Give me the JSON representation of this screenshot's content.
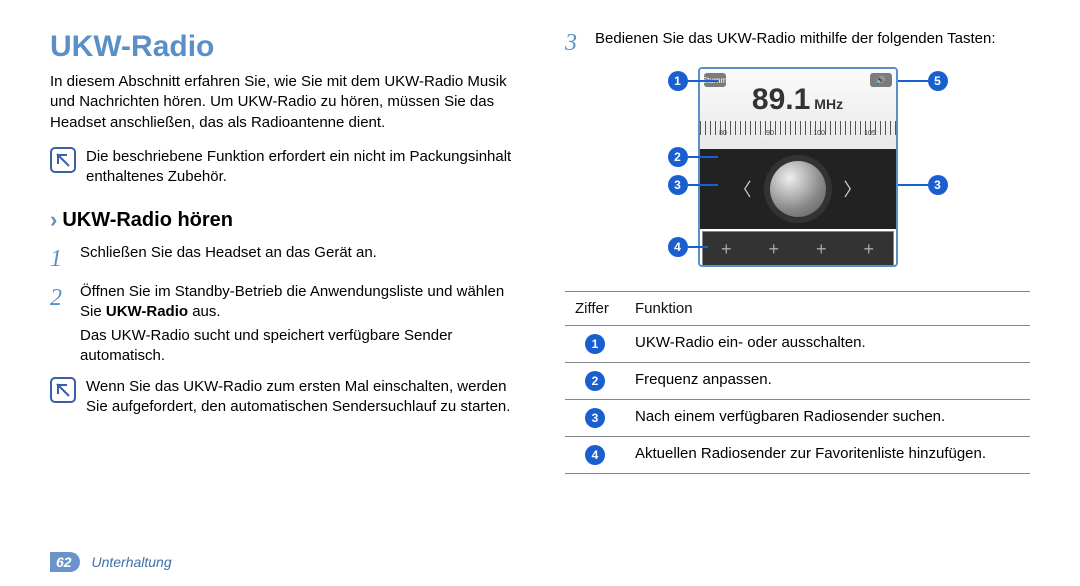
{
  "title": "UKW-Radio",
  "intro": "In diesem Abschnitt erfahren Sie, wie Sie mit dem UKW-Radio Musik und Nachrichten hören. Um UKW-Radio zu hören, müssen Sie das Headset anschließen, das als Radioantenne dient.",
  "note1": "Die beschriebene Funktion erfordert ein nicht im Packungsinhalt enthaltenes Zubehör.",
  "section_heading": "UKW-Radio hören",
  "step1": "Schließen Sie das Headset an das Gerät an.",
  "step2_a": "Öffnen Sie im Standby-Betrieb die Anwendungsliste und wählen Sie ",
  "step2_bold": "UKW-Radio",
  "step2_b": " aus.",
  "step2_sub": "Das UKW-Radio sucht und speichert verfügbare Sender automatisch.",
  "note2": "Wenn Sie das UKW-Radio zum ersten Mal einschalten, werden Sie aufgefordert, den automatischen Sendersuchlauf zu starten.",
  "step3": "Bedienen Sie das UKW-Radio mithilfe der folgenden Tasten:",
  "radio": {
    "frequency": "89.1",
    "unit": "MHz",
    "mute_label": "Stumm",
    "ticks": [
      "80",
      "90",
      "100",
      "105"
    ]
  },
  "callouts": {
    "c1": "1",
    "c2": "2",
    "c3": "3",
    "c4": "4",
    "c5": "5"
  },
  "table": {
    "h1": "Ziffer",
    "h2": "Funktion",
    "rows": [
      {
        "n": "1",
        "fn": "UKW-Radio ein- oder ausschalten."
      },
      {
        "n": "2",
        "fn": "Frequenz anpassen."
      },
      {
        "n": "3",
        "fn": "Nach einem verfügbaren Radiosender suchen."
      },
      {
        "n": "4",
        "fn": "Aktuellen Radiosender zur Favoritenliste hinzufügen."
      }
    ]
  },
  "footer": {
    "page": "62",
    "section": "Unterhaltung"
  }
}
